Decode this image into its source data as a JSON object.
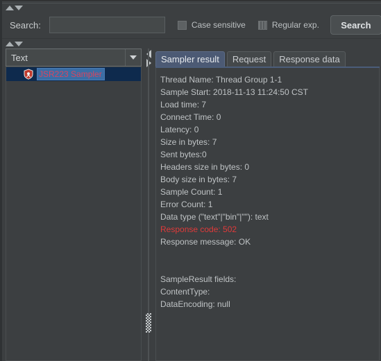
{
  "window": {
    "theme_bg": "#3c3f41",
    "accent": "#4c5a74",
    "error_color": "#e03a3a"
  },
  "search_bar": {
    "label": "Search:",
    "input_value": "",
    "input_placeholder": "",
    "case_sensitive_label": "Case sensitive",
    "case_sensitive_checked": false,
    "regular_exp_label": "Regular exp.",
    "regular_exp_checked": false,
    "search_button_label": "Search"
  },
  "left_panel": {
    "view_selector_value": "Text",
    "tree": {
      "items": [
        {
          "label": "JSR223 Sampler",
          "icon": "jsr223-sampler-icon",
          "selected": true,
          "label_color": "#d9455f"
        }
      ]
    }
  },
  "right_panel": {
    "tabs": [
      {
        "label": "Sampler result",
        "active": true
      },
      {
        "label": "Request",
        "active": false
      },
      {
        "label": "Response data",
        "active": false
      }
    ],
    "sampler_result": {
      "lines": [
        {
          "text": "Thread Name: Thread Group 1-1",
          "error": false
        },
        {
          "text": "Sample Start: 2018-11-13 11:24:50 CST",
          "error": false
        },
        {
          "text": "Load time: 7",
          "error": false
        },
        {
          "text": "Connect Time: 0",
          "error": false
        },
        {
          "text": "Latency: 0",
          "error": false
        },
        {
          "text": "Size in bytes: 7",
          "error": false
        },
        {
          "text": "Sent bytes:0",
          "error": false
        },
        {
          "text": "Headers size in bytes: 0",
          "error": false
        },
        {
          "text": "Body size in bytes: 7",
          "error": false
        },
        {
          "text": "Sample Count: 1",
          "error": false
        },
        {
          "text": "Error Count: 1",
          "error": false
        },
        {
          "text": "Data type (\"text\"|\"bin\"|\"\"): text",
          "error": false
        },
        {
          "text": "Response code: 502",
          "error": true
        },
        {
          "text": "Response message: OK",
          "error": false
        },
        {
          "text": "",
          "error": false
        },
        {
          "text": "",
          "error": false
        },
        {
          "text": "SampleResult fields:",
          "error": false
        },
        {
          "text": "ContentType:",
          "error": false
        },
        {
          "text": "DataEncoding: null",
          "error": false
        }
      ]
    }
  }
}
